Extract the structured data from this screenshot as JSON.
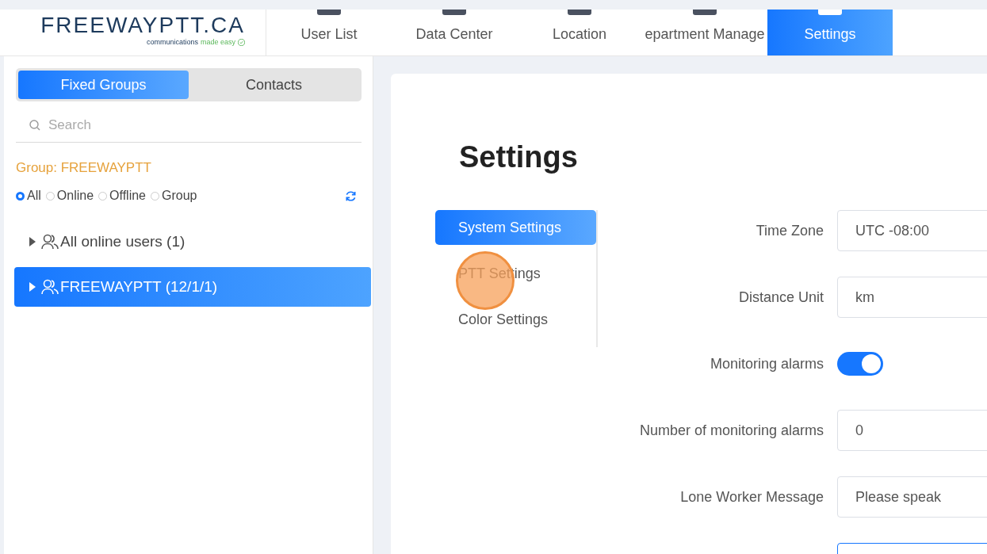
{
  "logo": {
    "name": "FREEWAYPTT.CA",
    "tagline_start": "communications",
    "tagline_end": "made easy"
  },
  "nav": [
    {
      "label": "User List",
      "selected": false
    },
    {
      "label": "Data Center",
      "selected": false
    },
    {
      "label": "Location",
      "selected": false
    },
    {
      "label": "epartment Manage",
      "selected": false
    },
    {
      "label": "Settings",
      "selected": true
    }
  ],
  "sidebar": {
    "tabs": [
      {
        "label": "Fixed Groups",
        "selected": true
      },
      {
        "label": "Contacts",
        "selected": false
      }
    ],
    "search": {
      "placeholder": "Search"
    },
    "group_label": "Group: FREEWAYPTT",
    "filters": [
      {
        "label": "All",
        "selected": true
      },
      {
        "label": "Online",
        "selected": false
      },
      {
        "label": "Offline",
        "selected": false
      },
      {
        "label": "Group",
        "selected": false
      }
    ],
    "tree": [
      {
        "label": "All online users (1)",
        "selected": false,
        "expanded": false
      },
      {
        "label": "FREEWAYPTT (12/1/1)",
        "selected": true,
        "expanded": false
      }
    ]
  },
  "page": {
    "title": "Settings",
    "menu": [
      {
        "label": "System Settings",
        "selected": true
      },
      {
        "label": "PTT Settings",
        "selected": false
      },
      {
        "label": "Color Settings",
        "selected": false
      }
    ],
    "fields": [
      {
        "kind": "input",
        "label": "Time Zone",
        "value": "UTC -08:00"
      },
      {
        "kind": "input",
        "label": "Distance Unit",
        "value": "km"
      },
      {
        "kind": "switch",
        "label": "Monitoring alarms",
        "on": true
      },
      {
        "kind": "input",
        "label": "Number of monitoring alarms",
        "value": "0"
      },
      {
        "kind": "input",
        "label": "Lone Worker Message",
        "value": "Please speak"
      },
      {
        "kind": "focused-input"
      }
    ]
  },
  "click_marker": {
    "shown": true
  }
}
